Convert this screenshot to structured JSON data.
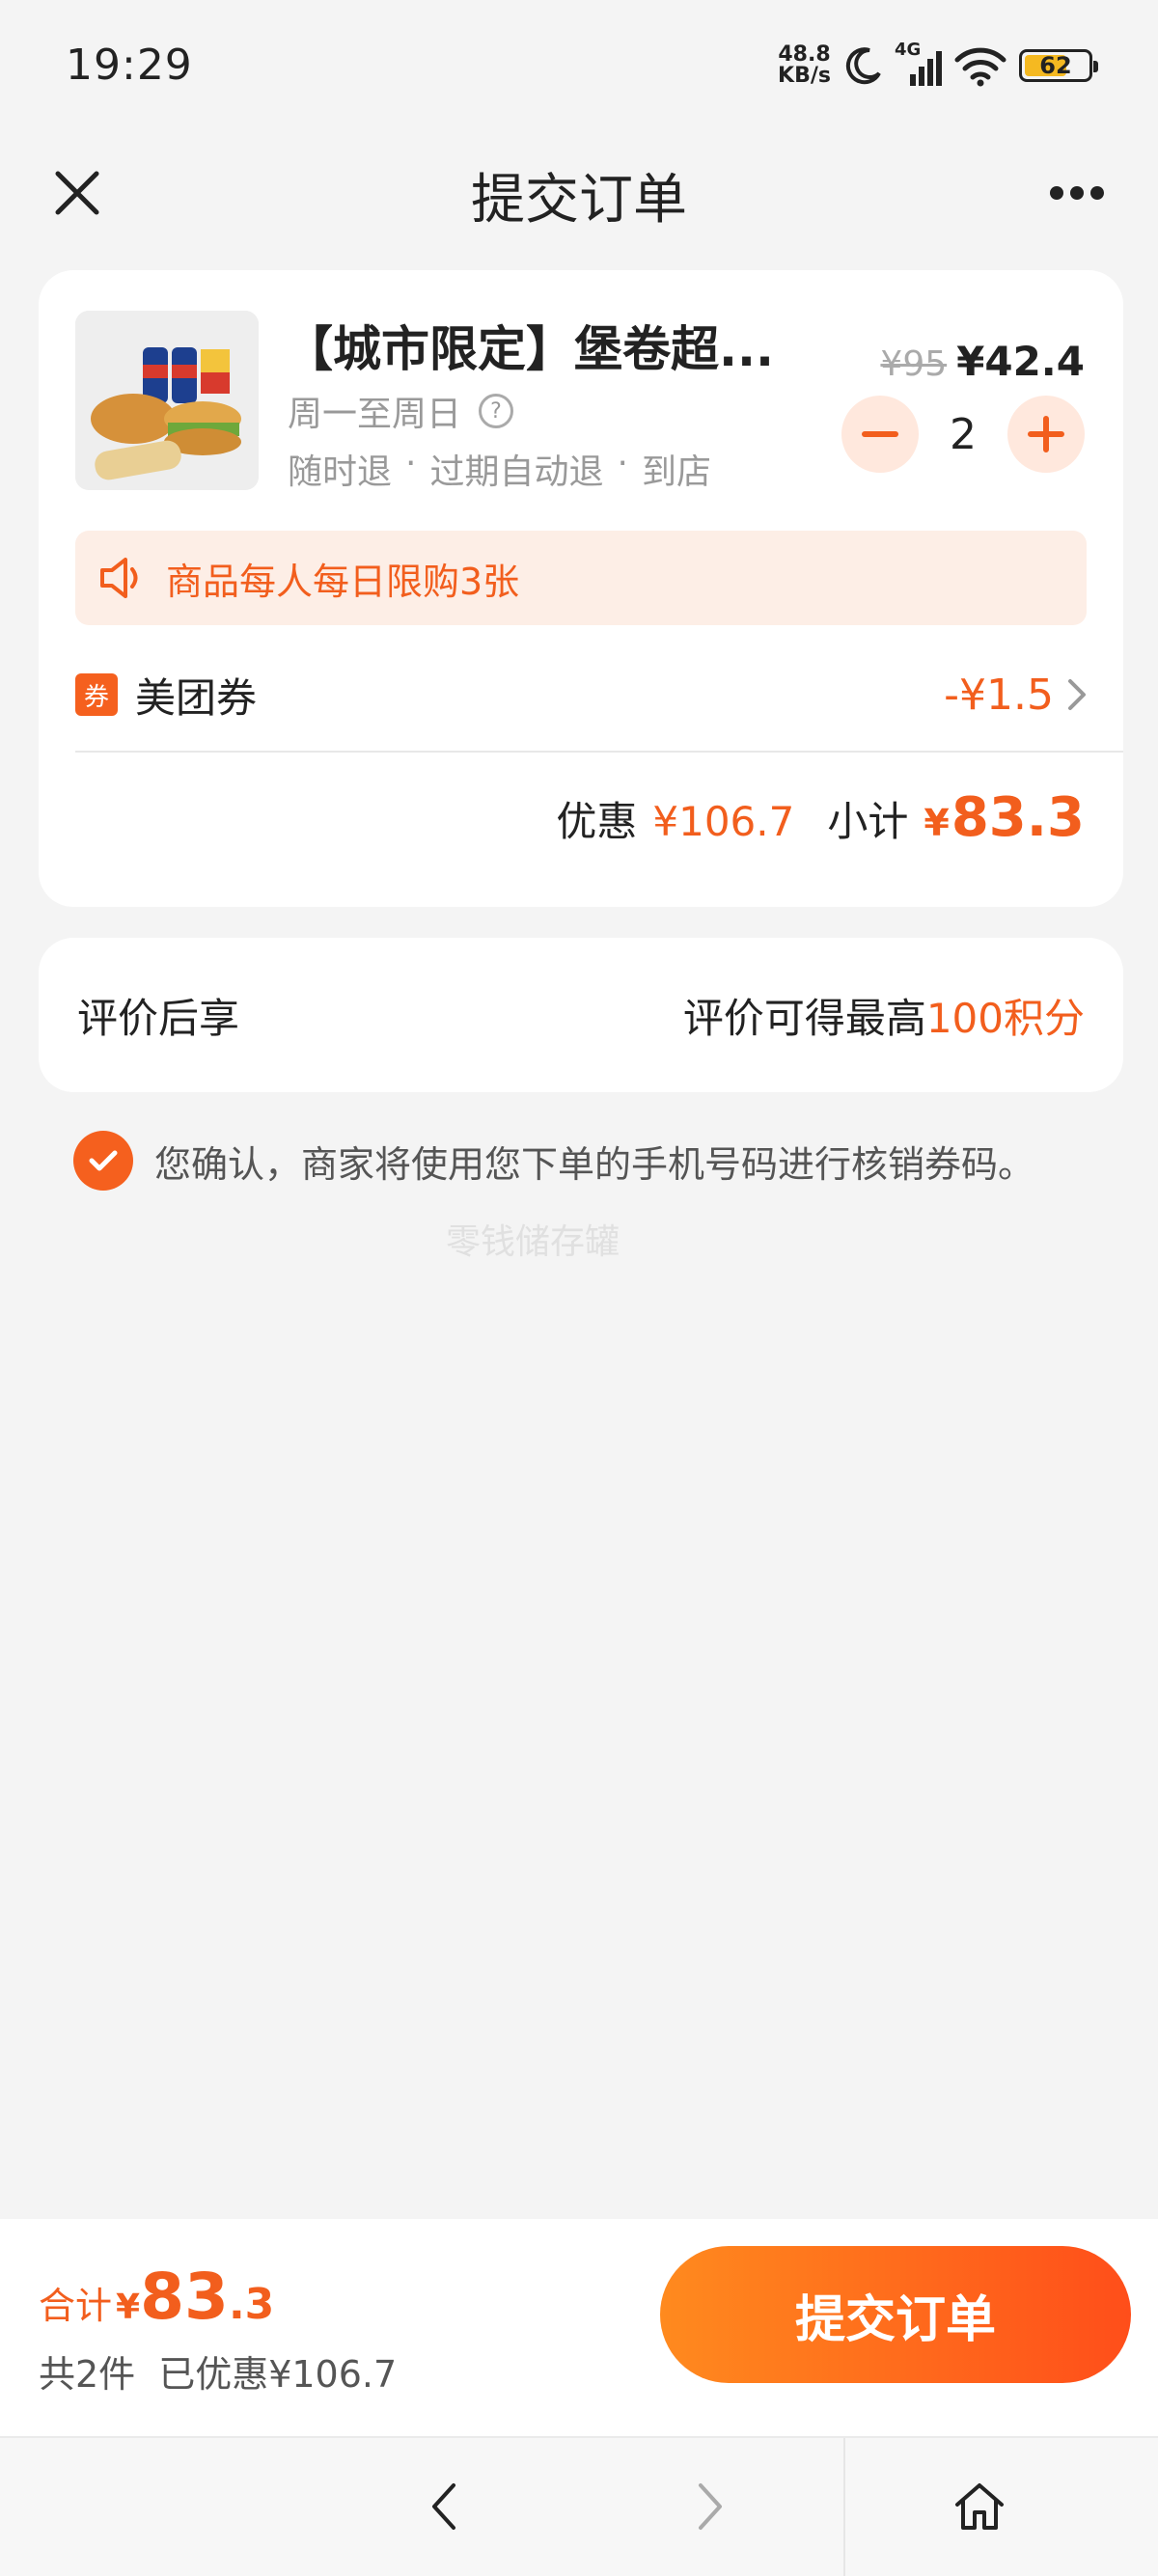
{
  "status_bar": {
    "time": "19:29",
    "net_speed_value": "48.8",
    "net_speed_unit": "KB/s",
    "network_type": "4G",
    "battery_level": "62"
  },
  "header": {
    "title": "提交订单"
  },
  "product": {
    "name": "【城市限定】堡卷超...",
    "valid_days": "周一至周日",
    "tags": [
      "随时退",
      "·",
      "过期自动退",
      "·",
      "到店"
    ],
    "original_price": "¥95",
    "price": "¥42.4",
    "quantity": "2"
  },
  "limit_notice": "商品每人每日限购3张",
  "coupon": {
    "badge": "券",
    "label": "美团券",
    "value": "-¥1.5"
  },
  "subtotal": {
    "discount_label": "优惠",
    "discount_value": "¥106.7",
    "label": "小计",
    "yen": "¥",
    "value": "83.3"
  },
  "review": {
    "label": "评价后享",
    "text_prefix": "评价可得最高",
    "text_highlight": "100积分"
  },
  "confirm_text": "您确认，商家将使用您下单的手机号码进行核销券码。",
  "watermark": "零钱储存罐",
  "footer": {
    "total_label": "合计",
    "total_yen": "¥",
    "total_int": "83",
    "total_dec": ".3",
    "count_text": "共2件",
    "saved_text": "已优惠¥106.7",
    "submit_label": "提交订单"
  },
  "colors": {
    "accent": "#f25e1d",
    "accent_light": "#fdeee6",
    "button_gradient_start": "#ff8a1e",
    "button_gradient_end": "#ff4e1a"
  }
}
